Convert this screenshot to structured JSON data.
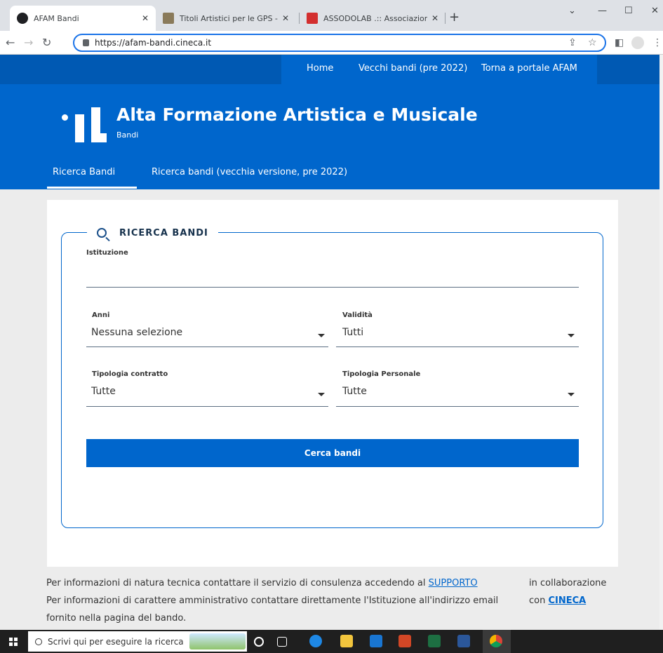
{
  "browser": {
    "tabs": [
      {
        "title": "AFAM Bandi"
      },
      {
        "title": "Titoli Artistici per le GPS - Titoli A"
      },
      {
        "title": "ASSODOLAB .:: Associazione Naz"
      }
    ],
    "url": "https://afam-bandi.cineca.it"
  },
  "topnav": {
    "home": "Home",
    "vecchi": "Vecchi bandi (pre 2022)",
    "torna": "Torna a portale AFAM"
  },
  "header": {
    "title": "Alta Formazione Artistica e Musicale",
    "subtitle": "Bandi"
  },
  "subnav": {
    "ricerca": "Ricerca Bandi",
    "vecchia": "Ricerca bandi (vecchia versione, pre 2022)"
  },
  "form": {
    "legend": "RICERCA BANDI",
    "istituzione_label": "Istituzione",
    "anni_label": "Anni",
    "anni_value": "Nessuna selezione",
    "validita_label": "Validità",
    "validita_value": "Tutti",
    "tipologia_contratto_label": "Tipologia contratto",
    "tipologia_contratto_value": "Tutte",
    "tipologia_personale_label": "Tipologia Personale",
    "tipologia_personale_value": "Tutte",
    "submit": "Cerca bandi"
  },
  "footer": {
    "line1": "Per informazioni di natura tecnica contattare il servizio di consulenza accedendo al ",
    "supporto": "SUPPORTO",
    "line2": "Per informazioni di carattere amministrativo contattare direttamente l'Istituzione all'indirizzo email",
    "line3": "fornito nella pagina del bando.",
    "collab1": "in collaborazione",
    "collab2": "con ",
    "cineca": "CINECA"
  },
  "taskbar": {
    "search_placeholder": "Scrivi qui per eseguire la ricerca"
  },
  "colors": {
    "primary": "#0066cc",
    "topnav": "#0059b3"
  }
}
